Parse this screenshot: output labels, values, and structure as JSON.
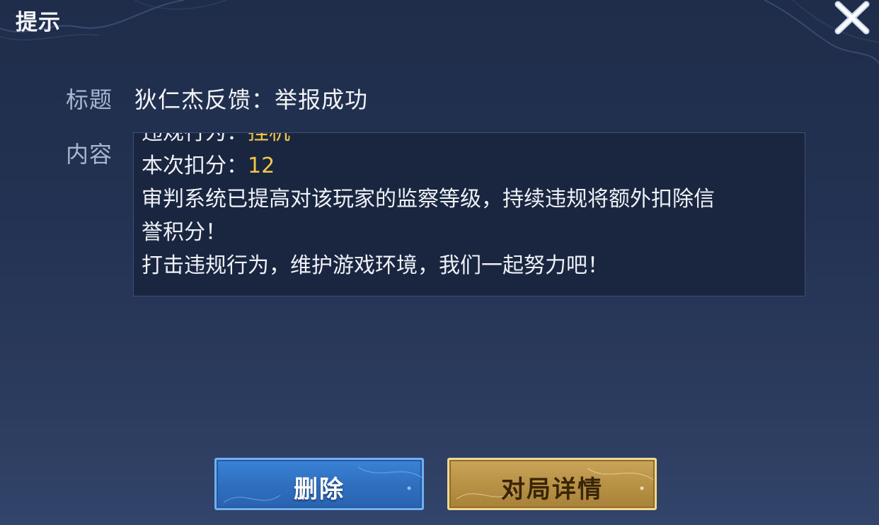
{
  "dialog": {
    "title": "提示",
    "close_icon": "close-icon"
  },
  "mail": {
    "title_label": "标题",
    "title_value": "狄仁杰反馈：举报成功",
    "content_label": "内容",
    "content": {
      "violation_prefix": "违规行为：",
      "violation_value": "挂机",
      "deduction_prefix": "本次扣分：",
      "deduction_value": "12",
      "line3": "审判系统已提高对该玩家的监察等级，持续违规将额外扣除信",
      "line4": "誉积分！",
      "line5": "打击违规行为，维护游戏环境，我们一起努力吧！"
    }
  },
  "buttons": {
    "delete_label": "删除",
    "details_label": "对局详情"
  },
  "colors": {
    "highlight": "#f2c744",
    "delete_button": "#2f6fc0",
    "details_button": "#b89245"
  }
}
